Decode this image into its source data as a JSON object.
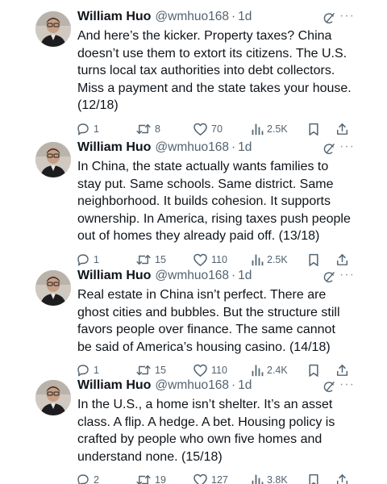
{
  "tweets": [
    {
      "author": "William Huo",
      "handle": "@wmhuo168",
      "separator": "·",
      "time": "1d",
      "text": "And here’s the kicker. Property taxes? China doesn’t use them to extort its citizens. The U.S. turns local tax authorities into debt collectors. Miss a payment and the state takes your house. (12/18)",
      "replies": "1",
      "retweets": "8",
      "likes": "70",
      "views": "2.5K"
    },
    {
      "author": "William Huo",
      "handle": "@wmhuo168",
      "separator": "·",
      "time": "1d",
      "text": "In China, the state actually wants families to stay put. Same schools. Same district. Same neighborhood. It builds cohesion. It supports ownership. In America, rising taxes push people out of homes they already paid off. (13/18)",
      "replies": "1",
      "retweets": "15",
      "likes": "110",
      "views": "2.5K"
    },
    {
      "author": "William Huo",
      "handle": "@wmhuo168",
      "separator": "·",
      "time": "1d",
      "text": "Real estate in China isn’t perfect. There are ghost cities and bubbles. But the structure still favors people over finance. The same cannot be said of America’s housing casino. (14/18)",
      "replies": "1",
      "retweets": "15",
      "likes": "110",
      "views": "2.4K"
    },
    {
      "author": "William Huo",
      "handle": "@wmhuo168",
      "separator": "·",
      "time": "1d",
      "text": "In the U.S., a home isn’t shelter. It’s an asset class. A flip. A hedge. A bet. Housing policy is crafted by people who own five homes and understand none. (15/18)",
      "replies": "2",
      "retweets": "19",
      "likes": "127",
      "views": "3.8K"
    }
  ],
  "icons": {
    "more": "···",
    "grok": "grok-icon",
    "reply": "reply-icon",
    "retweet": "retweet-icon",
    "like": "heart-icon",
    "views": "views-icon",
    "bookmark": "bookmark-icon",
    "share": "share-icon"
  },
  "colors": {
    "text": "#0f1419",
    "secondary": "#536471"
  }
}
